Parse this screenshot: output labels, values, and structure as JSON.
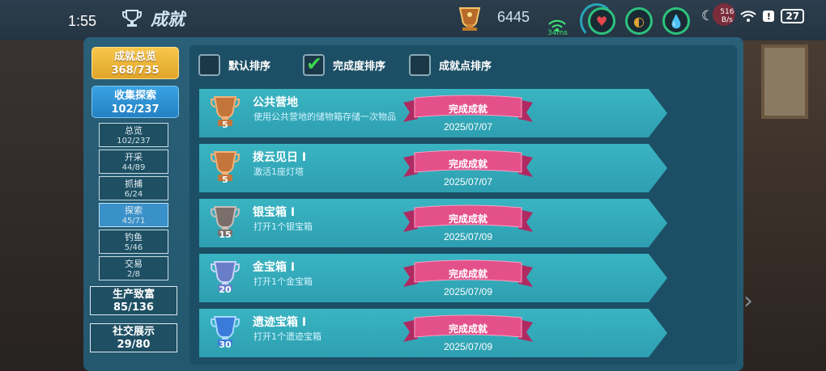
{
  "status": {
    "time": "1:55",
    "speed": "516",
    "speed_unit": "B/s",
    "battery": "27",
    "alert_icon": "!"
  },
  "header": {
    "title": "成就",
    "total_points": "6445",
    "ping": "34ms"
  },
  "nav": {
    "overview": {
      "label": "成就总览",
      "count": "368/735"
    },
    "collect": {
      "label": "收集探索",
      "count": "102/237"
    },
    "subs": [
      {
        "label": "总览",
        "count": "102/237"
      },
      {
        "label": "开采",
        "count": "44/89"
      },
      {
        "label": "抓捕",
        "count": "6/24"
      },
      {
        "label": "探索",
        "count": "45/71"
      },
      {
        "label": "钓鱼",
        "count": "5/46"
      },
      {
        "label": "交易",
        "count": "2/8"
      }
    ],
    "wealth": {
      "label": "生产致富",
      "count": "85/136"
    },
    "social": {
      "label": "社交展示",
      "count": "29/80"
    }
  },
  "sort": [
    {
      "label": "默认排序",
      "checked": false
    },
    {
      "label": "完成度排序",
      "checked": true
    },
    {
      "label": "成就点排序",
      "checked": false
    }
  ],
  "achievements": [
    {
      "name": "公共营地",
      "desc": "使用公共营地的储物箱存储一次物品",
      "points": "5",
      "status": "完成成就",
      "date": "2025/07/07",
      "badge": "bronze"
    },
    {
      "name": "拨云见日 I",
      "desc": "激活1座灯塔",
      "points": "5",
      "status": "完成成就",
      "date": "2025/07/07",
      "badge": "bronze"
    },
    {
      "name": "银宝箱 I",
      "desc": "打开1个银宝箱",
      "points": "15",
      "status": "完成成就",
      "date": "2025/07/09",
      "badge": "silver"
    },
    {
      "name": "金宝箱 I",
      "desc": "打开1个金宝箱",
      "points": "20",
      "status": "完成成就",
      "date": "2025/07/09",
      "badge": "gold"
    },
    {
      "name": "遗迹宝箱 I",
      "desc": "打开1个遗迹宝箱",
      "points": "30",
      "status": "完成成就",
      "date": "2025/07/09",
      "badge": "relic"
    }
  ],
  "colors": {
    "accent_gold": "#f2bd44",
    "active_blue": "#2d8fd0",
    "ribbon_pink": "#e0457c",
    "row_teal": "#35aabb"
  }
}
